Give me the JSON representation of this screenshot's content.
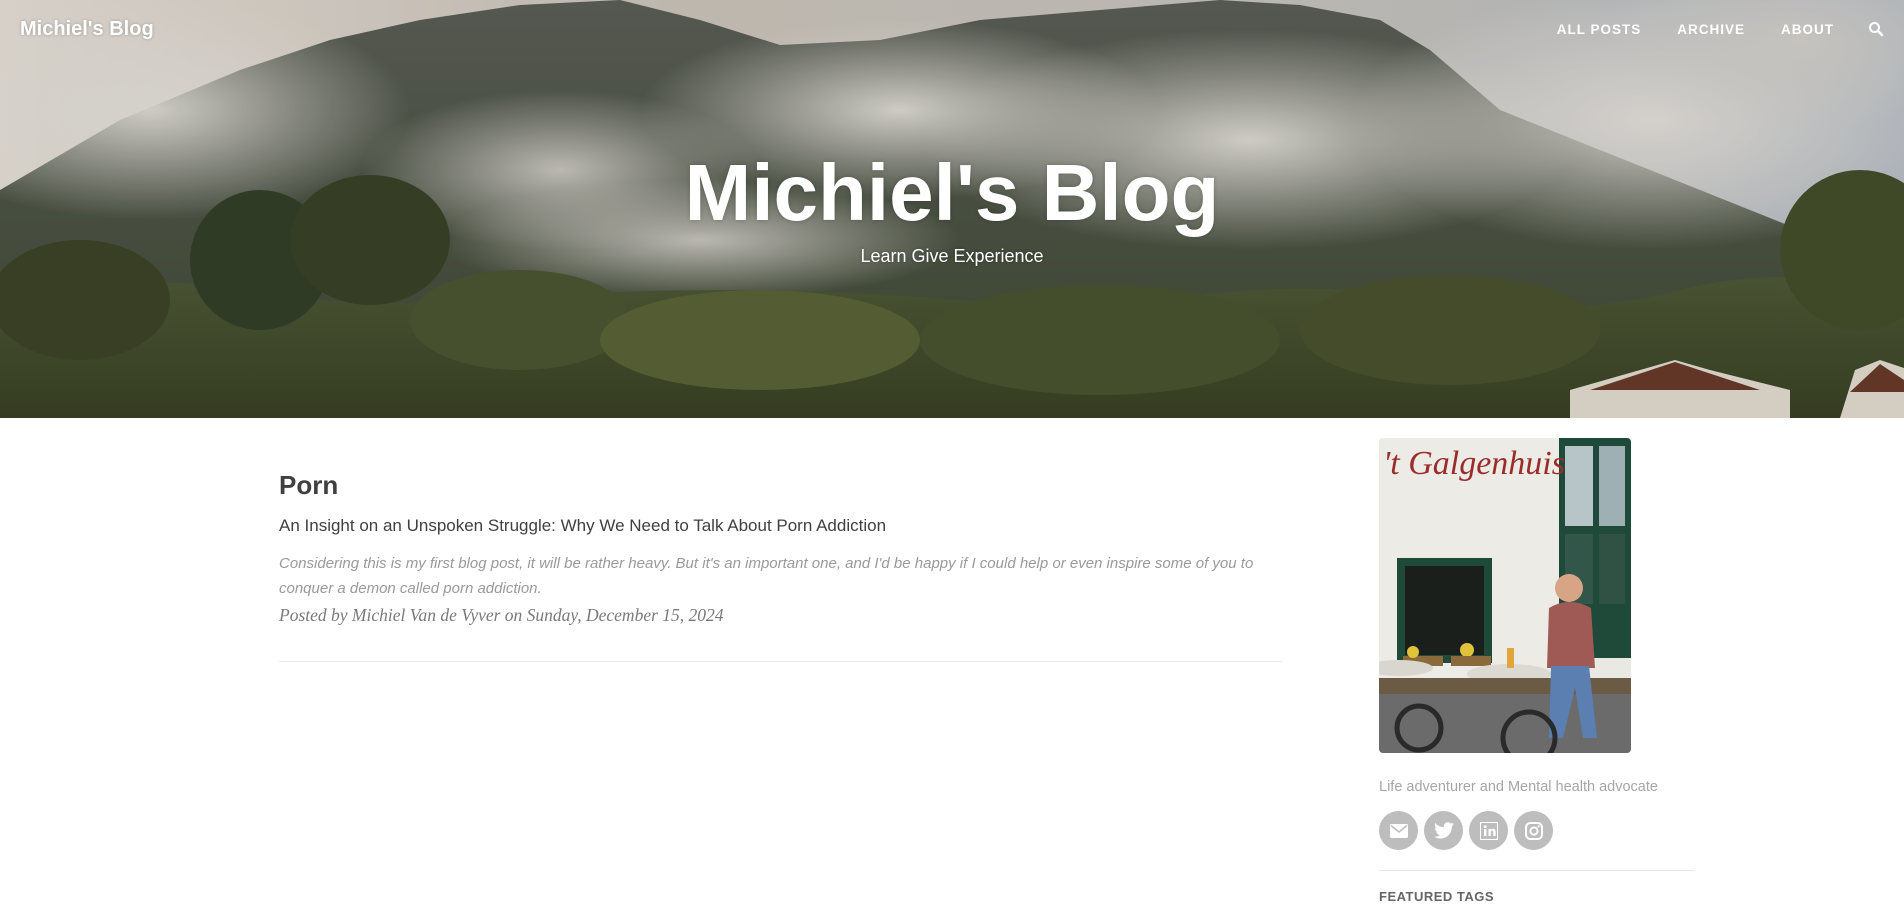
{
  "nav": {
    "brand": "Michiel's Blog",
    "links": [
      "ALL POSTS",
      "ARCHIVE",
      "ABOUT"
    ],
    "search_icon": "search-icon"
  },
  "hero": {
    "title": "Michiel's Blog",
    "subtitle": "Learn Give Experience"
  },
  "posts": [
    {
      "title": "Porn",
      "subtitle": "An Insight on an Unspoken Struggle: Why We Need to Talk About Porn Addiction",
      "excerpt": "Considering this is my first blog post, it will be rather heavy. But it's an important one, and I'd be happy if I could help or even inspire some of you to conquer a demon called porn addiction.",
      "meta": "Posted by Michiel Van de Vyver on Sunday, December 15, 2024"
    }
  ],
  "sidebar": {
    "avatar_sign": "'t Galgenhuis",
    "bio": "Life adventurer and Mental health advocate",
    "social": [
      "envelope-icon",
      "twitter-icon",
      "linkedin-icon",
      "instagram-icon"
    ],
    "featured_heading": "FEATURED TAGS"
  },
  "colors": {
    "accent_text": "#404040",
    "muted_text": "#9a9a9a",
    "social_bg": "#bdbdbd"
  }
}
